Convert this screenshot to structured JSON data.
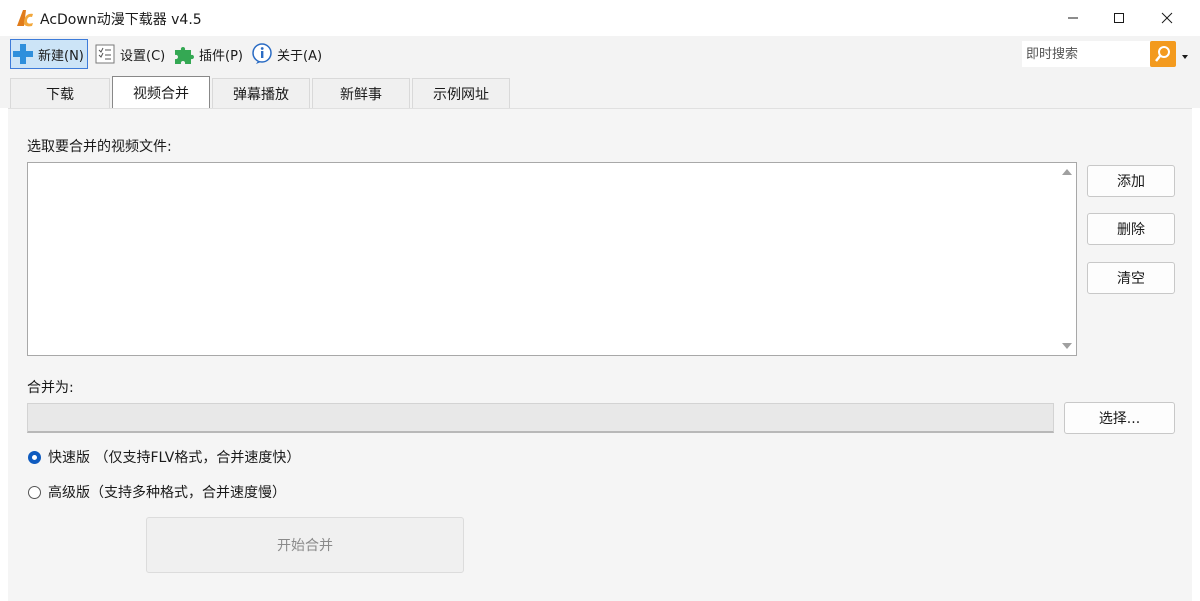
{
  "window": {
    "title": "AcDown动漫下载器 v4.5",
    "controls": {
      "minimize": "minimize-icon",
      "maximize": "maximize-icon",
      "close": "close-icon"
    }
  },
  "toolbar": {
    "new_label": "新建(N)",
    "settings_label": "设置(C)",
    "plugins_label": "插件(P)",
    "about_label": "关于(A)",
    "search_placeholder": "即时搜索",
    "accent_color": "#f39a1e"
  },
  "tabs": [
    {
      "label": "下载",
      "active": false
    },
    {
      "label": "视频合并",
      "active": true
    },
    {
      "label": "弹幕播放",
      "active": false
    },
    {
      "label": "新鲜事",
      "active": false
    },
    {
      "label": "示例网址",
      "active": false
    }
  ],
  "merge": {
    "select_files_label": "选取要合并的视频文件:",
    "add_button": "添加",
    "delete_button": "删除",
    "clear_button": "清空",
    "merge_as_label": "合并为:",
    "choose_button": "选择...",
    "options": [
      {
        "label": "快速版 （仅支持FLV格式，合并速度快）",
        "checked": true
      },
      {
        "label": "高级版（支持多种格式，合并速度慢）",
        "checked": false
      }
    ],
    "start_button": "开始合并"
  }
}
